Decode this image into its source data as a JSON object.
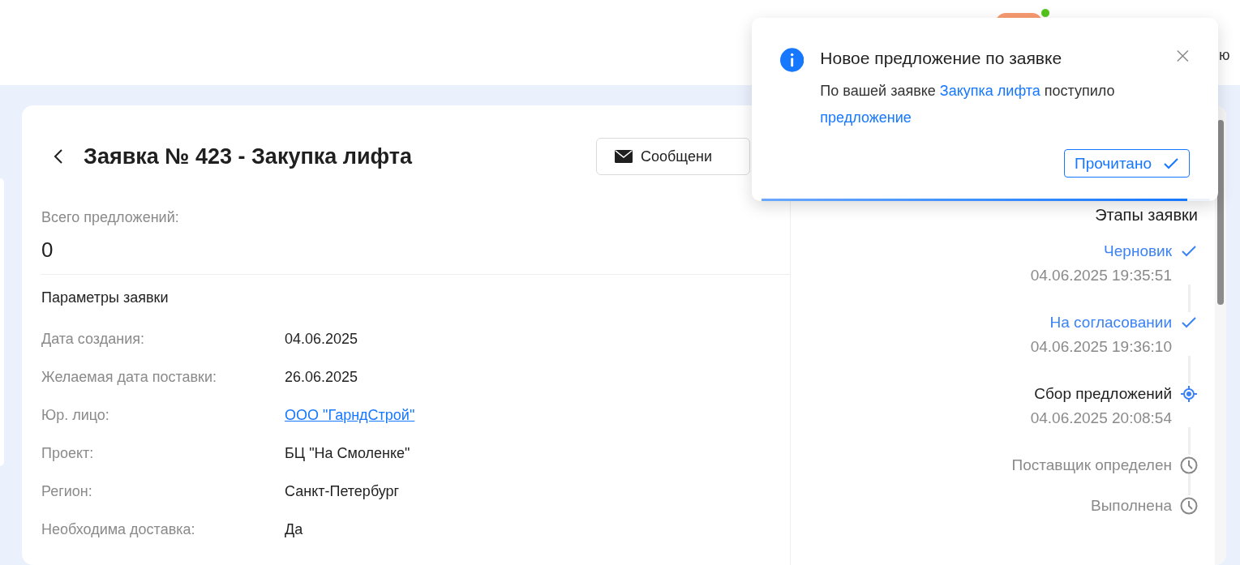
{
  "header": {
    "online": true,
    "user_fragment": "ю"
  },
  "request": {
    "title": "Заявка № 423 - Закупка лифта",
    "messages_button": "Сообщени",
    "offers_label": "Всего предложений:",
    "offers_count": "0",
    "params_title": "Параметры заявки",
    "fields": [
      {
        "label": "Дата создания:",
        "value": "04.06.2025",
        "kind": "text"
      },
      {
        "label": "Желаемая дата поставки:",
        "value": "26.06.2025",
        "kind": "text"
      },
      {
        "label": "Юр. лицо:",
        "value": "ООО \"ГарндСтрой\"",
        "kind": "link"
      },
      {
        "label": "Проект:",
        "value": "БЦ \"На Смоленке\"",
        "kind": "text"
      },
      {
        "label": "Регион:",
        "value": "Санкт-Петербург",
        "kind": "text"
      },
      {
        "label": "Необходима доставка:",
        "value": "Да",
        "kind": "text"
      }
    ]
  },
  "stages": {
    "title": "Этапы заявки",
    "items": [
      {
        "name": "Черновик",
        "date": "04.06.2025 19:35:51",
        "kind": "done"
      },
      {
        "name": "На согласовании",
        "date": "04.06.2025 19:36:10",
        "kind": "done"
      },
      {
        "name": "Сбор предложений",
        "date": "04.06.2025 20:08:54",
        "kind": "current"
      },
      {
        "name": "Поставщик определен",
        "kind": "pending"
      },
      {
        "name": "Выполнена",
        "kind": "pending"
      }
    ]
  },
  "notification": {
    "title": "Новое предложение по заявке",
    "message_parts": [
      {
        "text": "По вашей заявке ",
        "kind": "text"
      },
      {
        "text": "Закупка лифта",
        "kind": "link"
      },
      {
        "text": " поступило ",
        "kind": "text"
      },
      {
        "text": "предложение",
        "kind": "link"
      }
    ],
    "button": "Прочитано",
    "level": 0.95
  }
}
